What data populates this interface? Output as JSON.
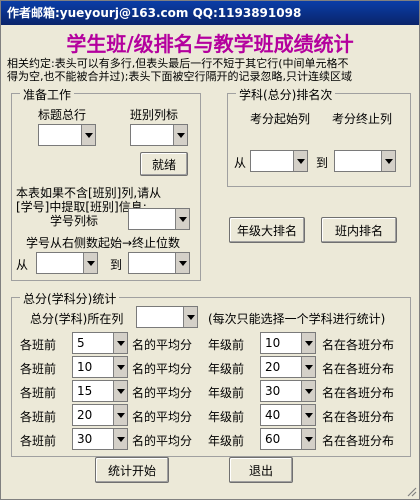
{
  "window": {
    "title": "作者邮箱:yueyourj@163.com QQ:1193891098",
    "main_title": "学生班/级排名与教学班成绩统计"
  },
  "notice": {
    "line1": "相关约定:表头可以有多行,但表头最后一行不短于其它行(中间单元格不",
    "line2": "得为空,也不能被合并过);表头下面被空行隔开的记录忽略,只计连续区域"
  },
  "prep": {
    "legend": "准备工作",
    "header_rows_label": "标题总行",
    "class_col_label": "班别列标",
    "ready_button": "就绪",
    "no_class_note_line1": "本表如果不含[班别]列,请从",
    "no_class_note_line2": "[学号]中提取[班别]信息:",
    "student_col_label": "学号列标",
    "digits_label": "学号从右侧数起始→终止位数",
    "from_label": "从",
    "to_label": "到"
  },
  "subject_rank": {
    "legend": "学科(总分)排名次",
    "start_label": "考分起始列",
    "end_label": "考分终止列",
    "from_label": "从",
    "to_label": "到"
  },
  "buttons": {
    "grade_rank": "年级大排名",
    "class_rank": "班内排名",
    "start_stats": "统计开始",
    "exit": "退出"
  },
  "stats": {
    "legend": "总分(学科分)统计",
    "total_col_label": "总分(学科)所在列",
    "note": "(每次只能选择一个学科进行统计)",
    "rows": [
      {
        "class_label": "各班前",
        "class_value": "5",
        "avg_label": "名的平均分",
        "grade_label": "年级前",
        "grade_value": "10",
        "dist_label": "名在各班分布"
      },
      {
        "class_label": "各班前",
        "class_value": "10",
        "avg_label": "名的平均分",
        "grade_label": "年级前",
        "grade_value": "20",
        "dist_label": "名在各班分布"
      },
      {
        "class_label": "各班前",
        "class_value": "15",
        "avg_label": "名的平均分",
        "grade_label": "年级前",
        "grade_value": "30",
        "dist_label": "名在各班分布"
      },
      {
        "class_label": "各班前",
        "class_value": "20",
        "avg_label": "名的平均分",
        "grade_label": "年级前",
        "grade_value": "40",
        "dist_label": "名在各班分布"
      },
      {
        "class_label": "各班前",
        "class_value": "30",
        "avg_label": "名的平均分",
        "grade_label": "年级前",
        "grade_value": "60",
        "dist_label": "名在各班分布"
      }
    ]
  },
  "colors": {
    "title_bar": "#0a246a",
    "main_title": "#b4009e",
    "window_bg": "#ece9d8"
  }
}
